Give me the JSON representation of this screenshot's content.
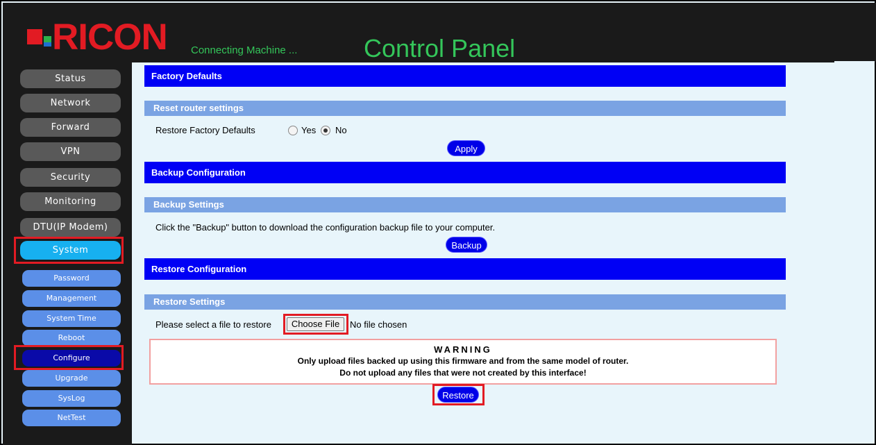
{
  "header": {
    "logo_text": "RICON",
    "tagline": "Connecting Machine ...",
    "title": "Control Panel"
  },
  "sidebar": {
    "main_items": [
      {
        "label": "Status"
      },
      {
        "label": "Network"
      },
      {
        "label": "Forward"
      },
      {
        "label": "VPN"
      },
      {
        "label": "Security"
      },
      {
        "label": "Monitoring"
      },
      {
        "label": "DTU(IP Modem)"
      },
      {
        "label": "System",
        "active": true
      }
    ],
    "sub_items": [
      {
        "label": "Password"
      },
      {
        "label": "Management"
      },
      {
        "label": "System Time"
      },
      {
        "label": "Reboot"
      },
      {
        "label": "Configure",
        "active": true
      },
      {
        "label": "Upgrade"
      },
      {
        "label": "SysLog"
      },
      {
        "label": "NetTest"
      }
    ]
  },
  "factory": {
    "section_title": "Factory Defaults",
    "sub_title": "Reset router settings",
    "field_label": "Restore Factory Defaults",
    "option_yes": "Yes",
    "option_no": "No",
    "selected": "No",
    "apply_label": "Apply"
  },
  "backup": {
    "section_title": "Backup Configuration",
    "sub_title": "Backup Settings",
    "description": "Click the \"Backup\" button to download the configuration backup file to your computer.",
    "button_label": "Backup"
  },
  "restore": {
    "section_title": "Restore Configuration",
    "sub_title": "Restore Settings",
    "field_label": "Please select a file to restore",
    "choose_file_label": "Choose File",
    "file_status": "No file chosen",
    "warning_title": "WARNING",
    "warning_line1": "Only upload files backed up using this firmware and from the same model of router.",
    "warning_line2": "Do not upload any files that were not created by this interface!",
    "button_label": "Restore"
  },
  "colors": {
    "section_bar": "#0000f5",
    "subsection_bar": "#7aa3e3",
    "highlight": "#e21b23",
    "brand_green": "#34c65a",
    "brand_red": "#e21b23"
  }
}
